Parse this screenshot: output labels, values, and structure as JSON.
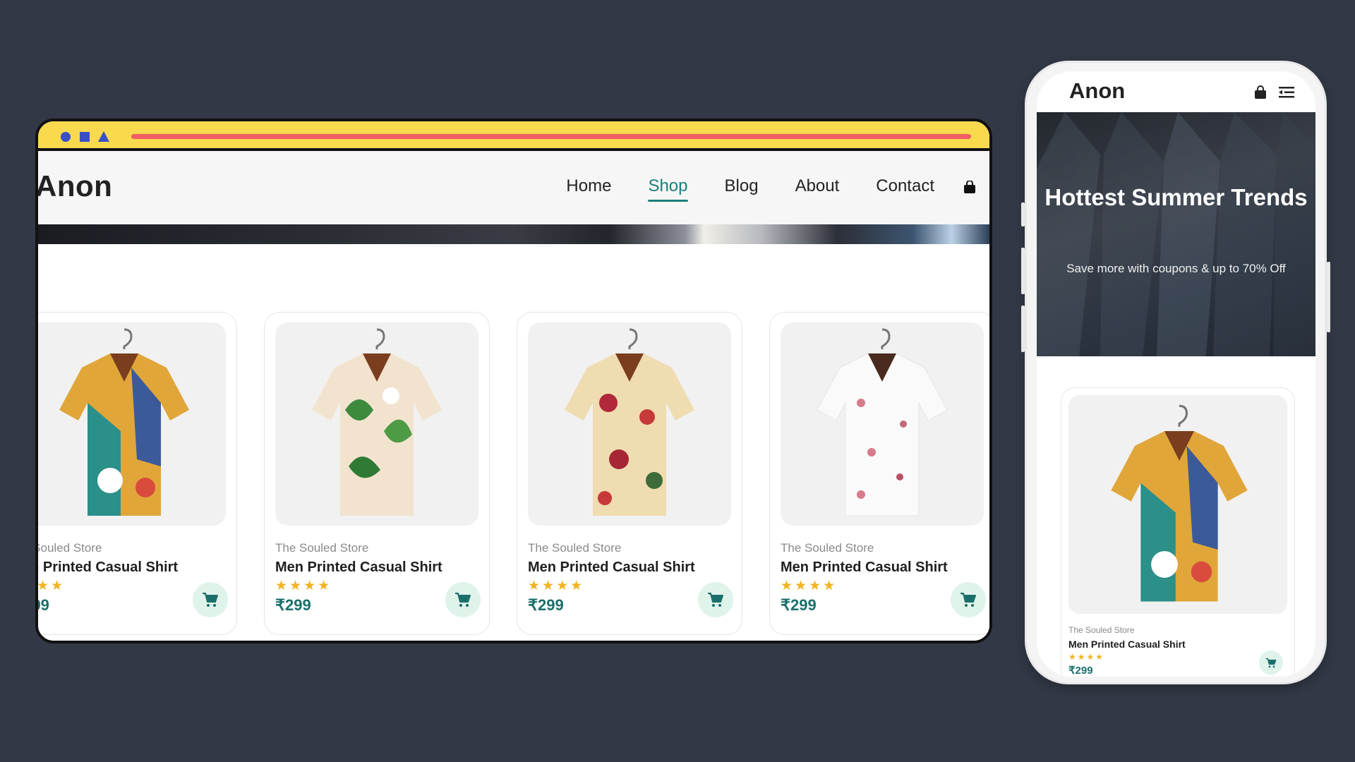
{
  "desktop": {
    "logo": "Anon",
    "nav": [
      {
        "label": "Home",
        "active": false
      },
      {
        "label": "Shop",
        "active": true
      },
      {
        "label": "Blog",
        "active": false
      },
      {
        "label": "About",
        "active": false
      },
      {
        "label": "Contact",
        "active": false
      }
    ],
    "products": [
      {
        "brand": "e Souled Store",
        "title": "en Printed Casual Shirt",
        "stars": "★★★",
        "price": "?99",
        "pattern": "abstract-multicolor"
      },
      {
        "brand": "The Souled Store",
        "title": "Men Printed Casual Shirt",
        "stars": "★★★★",
        "price": "₹299",
        "pattern": "leaf-floral"
      },
      {
        "brand": "The Souled Store",
        "title": "Men Printed Casual Shirt",
        "stars": "★★★★",
        "price": "₹299",
        "pattern": "rose-floral"
      },
      {
        "brand": "The Souled Store",
        "title": "Men Printed Casual Shirt",
        "stars": "★★★★",
        "price": "₹299",
        "pattern": "cherry-blossom"
      }
    ]
  },
  "mobile": {
    "logo": "Anon",
    "hero_title": "Hottest Summer Trends",
    "hero_subtitle": "Save more with coupons & up to 70% Off",
    "product": {
      "brand": "The Souled Store",
      "title": "Men Printed Casual Shirt",
      "stars": "★★★★",
      "price": "₹299",
      "pattern": "abstract-multicolor"
    }
  },
  "colors": {
    "page_background": "#323846",
    "titlebar": "#f9d94e",
    "titlebar_bar": "#f25d63",
    "titlebar_shapes": "#3a4fc4",
    "accent": "#1b7f7a",
    "star": "#f2b320",
    "cart_button": "#dff3ea"
  },
  "icons": [
    "shopping-bag-icon",
    "cart-icon",
    "menu-lines-icon",
    "star-icon"
  ]
}
